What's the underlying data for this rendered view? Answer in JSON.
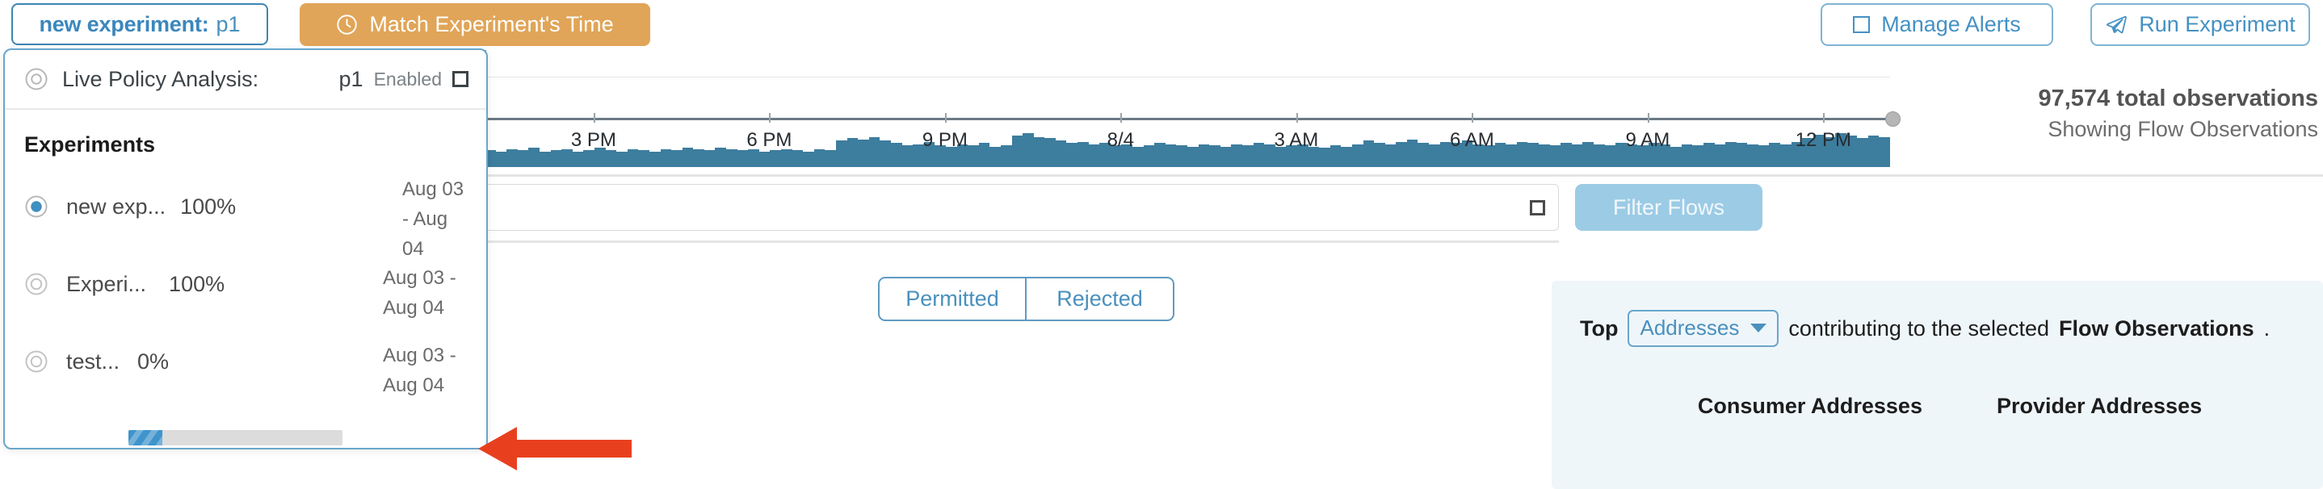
{
  "topbar": {
    "experiment_chip": {
      "label": "new experiment:",
      "value": "p1"
    },
    "match_button": {
      "label": "Match Experiment's Time",
      "icon": "clock-icon"
    },
    "manage_alerts": {
      "label": "Manage Alerts",
      "icon": "square-icon"
    },
    "run_experiment": {
      "label": "Run Experiment",
      "icon": "send-icon"
    }
  },
  "chart": {
    "axis_labels": [
      "3 PM",
      "6 PM",
      "9 PM",
      "8/4",
      "3 AM",
      "6 AM",
      "9 AM",
      "12 PM"
    ],
    "total_observations": "97,574 total observations",
    "showing": "Showing Flow Observations"
  },
  "chart_data": {
    "type": "area",
    "title": "",
    "xlabel": "",
    "ylabel": "",
    "categories": [
      "3 PM",
      "6 PM",
      "9 PM",
      "8/4",
      "3 AM",
      "6 AM",
      "9 AM",
      "12 PM"
    ],
    "x": [
      "3 PM",
      "6 PM",
      "9 PM",
      "8/4",
      "3 AM",
      "6 AM",
      "9 AM",
      "12 PM"
    ],
    "grid": true,
    "legend": "none",
    "series": [
      {
        "name": "Flow Observations",
        "color": "#3d7d9e",
        "values": [
          14,
          13,
          15,
          14,
          16,
          13,
          14,
          15,
          13,
          14,
          16,
          14,
          13,
          15,
          14,
          13,
          15,
          14,
          16,
          15,
          14,
          16,
          15,
          14,
          15,
          13,
          14,
          15,
          14,
          13,
          15,
          14,
          22,
          24,
          23,
          25,
          22,
          20,
          18,
          19,
          21,
          18,
          17,
          19,
          18,
          20,
          17,
          18,
          26,
          28,
          25,
          24,
          22,
          20,
          21,
          19,
          20,
          18,
          19,
          17,
          18,
          20,
          19,
          18,
          17,
          19,
          18,
          17,
          19,
          18,
          20,
          19,
          17,
          18,
          19,
          17,
          16,
          18,
          17,
          19,
          22,
          20,
          19,
          21,
          23,
          20,
          19,
          21,
          20,
          22,
          19,
          18,
          20,
          19,
          21,
          20,
          19,
          18,
          20,
          19,
          21,
          19,
          18,
          20,
          19,
          18,
          20,
          19,
          17,
          19,
          18,
          20,
          19,
          21,
          20,
          19,
          18,
          20,
          19,
          21,
          24,
          27,
          25,
          28,
          26,
          24,
          26,
          25
        ]
      }
    ]
  },
  "search": {
    "value": "",
    "placeholder": ""
  },
  "filter_flows": {
    "label": "Filter Flows"
  },
  "toggle": {
    "permitted": "Permitted",
    "rejected": "Rejected"
  },
  "top_panel": {
    "prefix": "Top",
    "select_value": "Addresses",
    "middle": "contributing to the selected",
    "emphasis": "Flow Observations",
    "suffix": ".",
    "consumer_header": "Consumer Addresses",
    "provider_header": "Provider Addresses"
  },
  "popup": {
    "header": {
      "icon": "ring-icon",
      "title": "Live Policy Analysis:",
      "policy": "p1",
      "state": "Enabled",
      "checkbox_icon": "square-icon"
    },
    "section_title": "Experiments",
    "experiments": [
      {
        "name": "new exp...",
        "percent": "100%",
        "dates": "Aug 03 - Aug 04",
        "selected": true,
        "progress": null
      },
      {
        "name": "Experi...",
        "percent": "100%",
        "dates": "Aug 03 - Aug 04",
        "selected": false,
        "progress": null
      },
      {
        "name": "test...",
        "percent": "0%",
        "dates": "Aug 03 - Aug 04",
        "selected": false,
        "progress": 16
      }
    ]
  },
  "annotation": {
    "arrow_color": "#e8401f",
    "points_to": "experiment-list-bottom"
  },
  "colors": {
    "accent_blue": "#4a90bd",
    "border_blue": "#6aa6cb",
    "orange": "#e0a558",
    "chart_blue": "#3d7d9e",
    "panel_bg": "#eff6fa",
    "red": "#e8401f"
  }
}
